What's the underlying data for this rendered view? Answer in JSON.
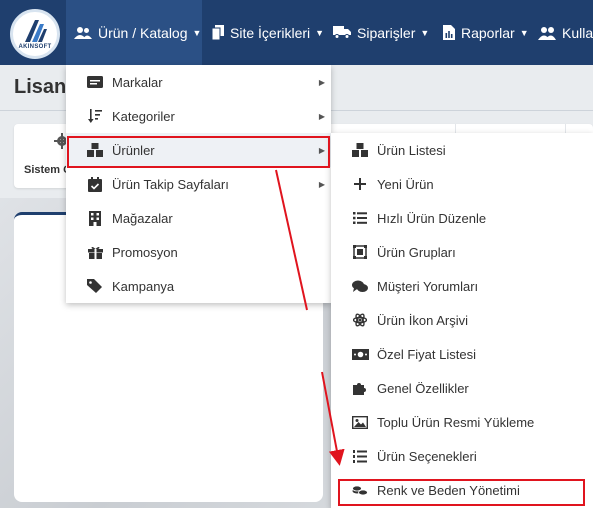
{
  "logo": {
    "text": "AKINSOFT"
  },
  "navbar": {
    "items": [
      {
        "label": "Ürün / Katalog",
        "icon": "users-icon"
      },
      {
        "label": "Site İçerikleri",
        "icon": "copy-icon"
      },
      {
        "label": "Siparişler",
        "icon": "truck-icon"
      },
      {
        "label": "Raporlar",
        "icon": "file-report-icon"
      },
      {
        "label": "Kullan",
        "icon": "user-group-icon"
      }
    ]
  },
  "page": {
    "title": "Lisan",
    "system_card_label": "Sistem G"
  },
  "dropdown": {
    "items": [
      {
        "label": "Markalar",
        "icon": "id-card-icon",
        "has_submenu": true
      },
      {
        "label": "Kategoriler",
        "icon": "sort-icon",
        "has_submenu": true
      },
      {
        "label": "Ürünler",
        "icon": "boxes-icon",
        "has_submenu": true
      },
      {
        "label": "Ürün Takip Sayfaları",
        "icon": "calendar-check-icon",
        "has_submenu": true
      },
      {
        "label": "Mağazalar",
        "icon": "building-icon",
        "has_submenu": false
      },
      {
        "label": "Promosyon",
        "icon": "gift-icon",
        "has_submenu": false
      },
      {
        "label": "Kampanya",
        "icon": "tags-icon",
        "has_submenu": false
      }
    ]
  },
  "submenu": {
    "items": [
      {
        "label": "Ürün Listesi",
        "icon": "boxes-icon"
      },
      {
        "label": "Yeni Ürün",
        "icon": "plus-icon"
      },
      {
        "label": "Hızlı Ürün Düzenle",
        "icon": "list-icon"
      },
      {
        "label": "Ürün Grupları",
        "icon": "object-group-icon"
      },
      {
        "label": "Müşteri Yorumları",
        "icon": "comments-icon"
      },
      {
        "label": "Ürün İkon Arşivi",
        "icon": "atom-icon"
      },
      {
        "label": "Özel Fiyat Listesi",
        "icon": "money-bill-icon"
      },
      {
        "label": "Genel Özellikler",
        "icon": "puzzle-icon"
      },
      {
        "label": "Toplu Ürün Resmi Yükleme",
        "icon": "image-icon"
      },
      {
        "label": "Ürün Seçenekleri",
        "icon": "list-ol-icon"
      },
      {
        "label": "Renk ve Beden Yönetimi",
        "icon": "coins-icon"
      }
    ]
  },
  "colors": {
    "navbar": "#1f3f6e",
    "navbar_active": "#2b5085",
    "highlight": "#e0141e",
    "hover": "#eef1f5"
  }
}
